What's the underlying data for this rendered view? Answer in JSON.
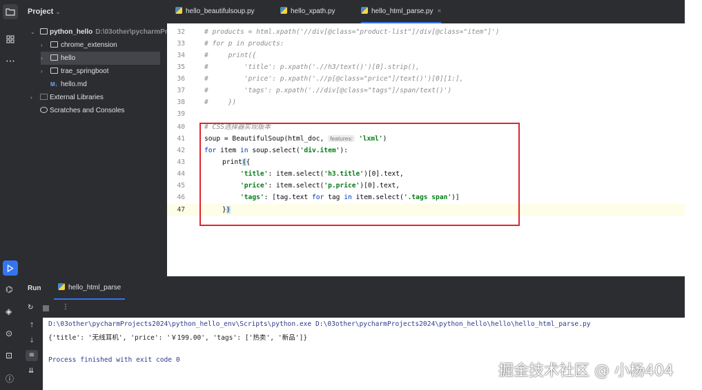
{
  "project_panel": {
    "title": "Project",
    "tree": [
      {
        "label": "python_hello",
        "detail": "D:\\03other\\pycharmPr"
      },
      {
        "label": "chrome_extension"
      },
      {
        "label": "hello"
      },
      {
        "label": "trae_springboot"
      },
      {
        "label": "hello.md",
        "prefix": "M↓"
      },
      {
        "label": "External Libraries"
      },
      {
        "label": "Scratches and Consoles"
      }
    ]
  },
  "editor": {
    "tabs": [
      {
        "label": "hello_beautifulsoup.py"
      },
      {
        "label": "hello_xpath.py"
      },
      {
        "label": "hello_html_parse.py",
        "close": "×"
      }
    ],
    "line_numbers": [
      "32",
      "33",
      "34",
      "35",
      "36",
      "37",
      "38",
      "39",
      "40",
      "41",
      "42",
      "43",
      "44",
      "45",
      "46",
      "47"
    ],
    "lines": {
      "l32": "# products = html.xpath('//div[@class=\"product-list\"]/div[@class=\"item\"]')",
      "l33": "# for p in products:",
      "l34": "#     print({",
      "l35": "#         'title': p.xpath('.//h3/text()')[0].strip(),",
      "l36": "#         'price': p.xpath('.//p[@class=\"price\"]/text()')[0][1:],",
      "l37": "#         'tags': p.xpath('.//div[@class=\"tags\"]/span/text()')",
      "l38": "#     })",
      "l40": "# CSS选择器实现版本",
      "l41_a": "soup = BeautifulSoup(html_doc, ",
      "l41_hint": "features:",
      "l41_b": "'lxml'",
      "l41_c": ")",
      "l42_kw1": "for",
      "l42_a": " item ",
      "l42_kw2": "in",
      "l42_b": " soup.select(",
      "l42_s": "'div.item'",
      "l42_c": "):",
      "l43_a": "print",
      "l43_b": "(",
      "l43_c": "{",
      "l44_s": "'title'",
      "l44_a": ": item.select(",
      "l44_s2": "'h3.title'",
      "l44_b": ")[0].text,",
      "l45_s": "'price'",
      "l45_a": ": item.select(",
      "l45_s2": "'p.price'",
      "l45_b": ")[0].text,",
      "l46_s": "'tags'",
      "l46_a": ": [tag.text ",
      "l46_kw1": "for",
      "l46_b": " tag ",
      "l46_kw2": "in",
      "l46_c": " item.select(",
      "l46_s2": "'.tags span'",
      "l46_d": ")]",
      "l47_a": "}",
      "l47_b": ")"
    }
  },
  "run_panel": {
    "label": "Run",
    "tab": "hello_html_parse",
    "console": {
      "command": "D:\\03other\\pycharmProjects2024\\python_hello_env\\Scripts\\python.exe D:\\03other\\pycharmProjects2024\\python_hello\\hello\\hello_html_parse.py",
      "output": "{'title': '无线耳机', 'price': '￥199.00', 'tags': ['热卖', '新品']}",
      "exit": "Process finished with exit code 0"
    }
  },
  "watermark": "掘金技术社区 @ 小杨404",
  "colors": {
    "accent": "#3574f0",
    "highlight_box": "#e0242f",
    "comment": "#8c8c8c",
    "keyword": "#0033b3",
    "string": "#067d17"
  }
}
